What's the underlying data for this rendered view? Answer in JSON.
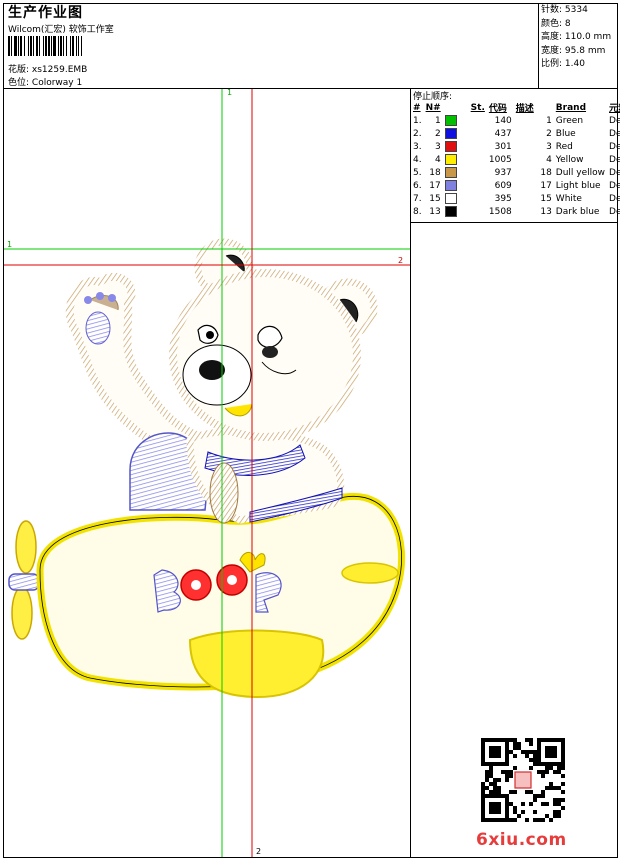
{
  "header": {
    "title": "生产作业图",
    "subtitle": "Wilcom(汇宏) 软饰工作室",
    "design_label": "花版:",
    "design_value": "xs1259.EMB",
    "colorway_label": "色位:",
    "colorway_value": "Colorway 1"
  },
  "specs": {
    "stitches_label": "针数:",
    "stitches_value": "5334",
    "colors_label": "颜色:",
    "colors_value": "8",
    "height_label": "高度:",
    "height_value": "110.0 mm",
    "width_label": "宽度:",
    "width_value": "95.8 mm",
    "scale_label": "比例:",
    "scale_value": "1.40"
  },
  "sequence": {
    "title": "停止顺序:",
    "columns": [
      "#",
      "N#",
      "St.",
      "代码",
      "描述",
      "Brand",
      "元素"
    ],
    "rows": [
      {
        "idx": "1.",
        "n": "1",
        "st": "140",
        "code": "1",
        "desc": "Green",
        "brand": "Default",
        "color": "#00c000"
      },
      {
        "idx": "2.",
        "n": "2",
        "st": "437",
        "code": "2",
        "desc": "Blue",
        "brand": "Default",
        "color": "#1010e0"
      },
      {
        "idx": "3.",
        "n": "3",
        "st": "301",
        "code": "3",
        "desc": "Red",
        "brand": "Default",
        "color": "#e01010"
      },
      {
        "idx": "4.",
        "n": "4",
        "st": "1005",
        "code": "4",
        "desc": "Yellow",
        "brand": "Default",
        "color": "#ffee00"
      },
      {
        "idx": "5.",
        "n": "18",
        "st": "937",
        "code": "18",
        "desc": "Dull yellow",
        "brand": "Default",
        "color": "#c89848"
      },
      {
        "idx": "6.",
        "n": "17",
        "st": "609",
        "code": "17",
        "desc": "Light blue",
        "brand": "Default",
        "color": "#8080e0"
      },
      {
        "idx": "7.",
        "n": "15",
        "st": "395",
        "code": "15",
        "desc": "White",
        "brand": "Default",
        "color": "#ffffff"
      },
      {
        "idx": "8.",
        "n": "13",
        "st": "1508",
        "code": "13",
        "desc": "Dark blue",
        "brand": "Default",
        "color": "#000000"
      }
    ]
  },
  "guides": {
    "green_v": "1",
    "green_h": "1",
    "red_h": "2",
    "red_v": "2"
  },
  "watermark": "6xiu.com",
  "colors": {
    "guide_green": "#00cc00",
    "guide_red": "#dd0000",
    "accent": "#e63c3c"
  }
}
